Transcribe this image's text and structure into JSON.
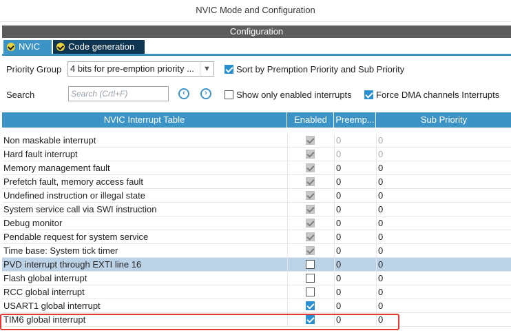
{
  "window": {
    "title": "NVIC Mode and Configuration"
  },
  "config_header": "Configuration",
  "tabs": [
    {
      "label": "NVIC",
      "active": true
    },
    {
      "label": "Code generation",
      "active": false
    }
  ],
  "priority_group": {
    "label": "Priority Group",
    "value": "4 bits for pre-emption priority ..."
  },
  "sort_option": {
    "label": "Sort by Premption Priority and Sub Priority",
    "checked": true
  },
  "search": {
    "label": "Search",
    "placeholder": "Search (Crtl+F)"
  },
  "show_enabled": {
    "label": "Show only enabled interrupts",
    "checked": false
  },
  "force_dma": {
    "label": "Force DMA channels Interrupts",
    "checked": true
  },
  "table": {
    "headers": [
      "NVIC Interrupt Table",
      "Enabled",
      "Preemp...",
      "Sub Priority"
    ],
    "rows": [
      {
        "name": "Non maskable interrupt",
        "enabled": "disabled-checked",
        "preempt": "0",
        "sub": "0",
        "editable": false
      },
      {
        "name": "Hard fault interrupt",
        "enabled": "disabled-checked",
        "preempt": "0",
        "sub": "0",
        "editable": false
      },
      {
        "name": "Memory management fault",
        "enabled": "disabled-checked",
        "preempt": "0",
        "sub": "0",
        "editable": true
      },
      {
        "name": "Prefetch fault, memory access fault",
        "enabled": "disabled-checked",
        "preempt": "0",
        "sub": "0",
        "editable": true
      },
      {
        "name": "Undefined instruction or illegal state",
        "enabled": "disabled-checked",
        "preempt": "0",
        "sub": "0",
        "editable": true
      },
      {
        "name": "System service call via SWI instruction",
        "enabled": "disabled-checked",
        "preempt": "0",
        "sub": "0",
        "editable": true
      },
      {
        "name": "Debug monitor",
        "enabled": "disabled-checked",
        "preempt": "0",
        "sub": "0",
        "editable": true
      },
      {
        "name": "Pendable request for system service",
        "enabled": "disabled-checked",
        "preempt": "0",
        "sub": "0",
        "editable": true
      },
      {
        "name": "Time base: System tick timer",
        "enabled": "disabled-checked",
        "preempt": "0",
        "sub": "0",
        "editable": true
      },
      {
        "name": "PVD interrupt through EXTI line 16",
        "enabled": "unchecked",
        "preempt": "0",
        "sub": "0",
        "editable": true,
        "selected": true
      },
      {
        "name": "Flash global interrupt",
        "enabled": "unchecked",
        "preempt": "0",
        "sub": "0",
        "editable": true
      },
      {
        "name": "RCC global interrupt",
        "enabled": "unchecked",
        "preempt": "0",
        "sub": "0",
        "editable": true
      },
      {
        "name": "USART1 global interrupt",
        "enabled": "checked",
        "preempt": "0",
        "sub": "0",
        "editable": true
      },
      {
        "name": "TIM6 global interrupt",
        "enabled": "checked",
        "preempt": "0",
        "sub": "0",
        "editable": true
      }
    ]
  },
  "colors": {
    "accent": "#3c94c6",
    "tab_inactive": "#0f3550",
    "selected_row": "#bcd2e7",
    "highlight": "#e53935"
  }
}
